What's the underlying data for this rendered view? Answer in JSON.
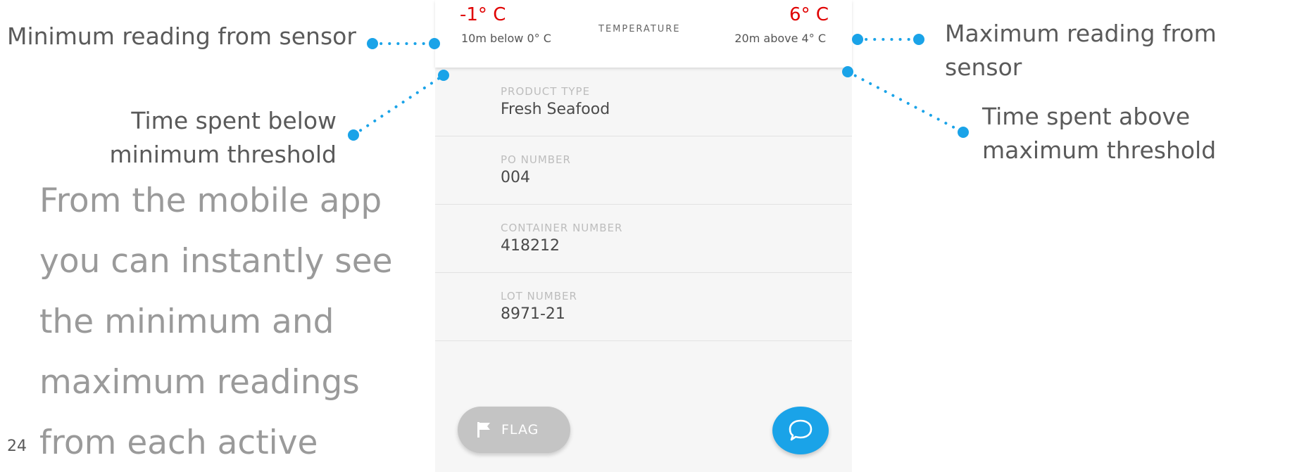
{
  "callouts": {
    "min_reading": "Minimum reading from sensor",
    "max_reading": "Maximum reading from sensor",
    "time_below_line1": "Time spent below",
    "time_below_line2": "minimum threshold",
    "time_above_line1": "Time spent above",
    "time_above_line2": "maximum threshold"
  },
  "body_text": [
    "From the mobile app",
    "you can instantly see",
    "the minimum and",
    "maximum readings",
    "from each active"
  ],
  "page_number": "24",
  "app": {
    "header": {
      "title": "TEMPERATURE",
      "min_value": "-1° C",
      "min_sub": "10m below 0° C",
      "max_value": "6° C",
      "max_sub": "20m above 4° C"
    },
    "fields": [
      {
        "label": "PRODUCT TYPE",
        "value": "Fresh Seafood"
      },
      {
        "label": "PO NUMBER",
        "value": "004"
      },
      {
        "label": "CONTAINER NUMBER",
        "value": "418212"
      },
      {
        "label": "LOT NUMBER",
        "value": "8971-21"
      }
    ],
    "flag_button": {
      "label": "FLAG",
      "icon": "flag-icon"
    },
    "chat_button": {
      "icon": "chat-bubble-icon"
    }
  },
  "colors": {
    "accent_blue": "#1aa3e8",
    "alert_red": "#e00000",
    "flag_grey": "#c4c4c4"
  }
}
